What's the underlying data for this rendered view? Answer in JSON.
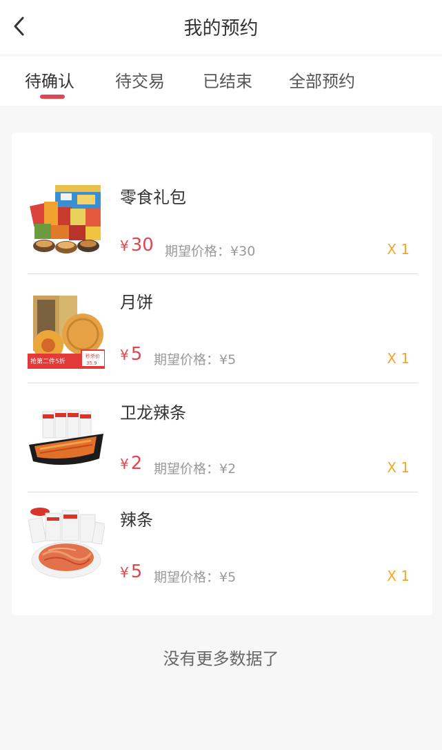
{
  "header": {
    "title": "我的预约"
  },
  "tabs": [
    {
      "label": "待确认",
      "active": true
    },
    {
      "label": "待交易",
      "active": false
    },
    {
      "label": "已结束",
      "active": false
    },
    {
      "label": "全部预约",
      "active": false
    }
  ],
  "items": [
    {
      "name": "零食礼包",
      "currency": "¥",
      "price": "30",
      "expect_label": "期望价格：",
      "expect_price": "¥30",
      "qty": "X 1",
      "image": "snack-gift-box-image"
    },
    {
      "name": "月饼",
      "currency": "¥",
      "price": "5",
      "expect_label": "期望价格：",
      "expect_price": "¥5",
      "qty": "X 1",
      "image": "mooncake-image",
      "image_text": {
        "promo": "抢第二件5折",
        "badge": "秒杀价",
        "badge_price": "35.9"
      }
    },
    {
      "name": "卫龙辣条",
      "currency": "¥",
      "price": "2",
      "expect_label": "期望价格：",
      "expect_price": "¥2",
      "qty": "X 1",
      "image": "weilong-latiao-image"
    },
    {
      "name": "辣条",
      "currency": "¥",
      "price": "5",
      "expect_label": "期望价格：",
      "expect_price": "¥5",
      "qty": "X 1",
      "image": "latiao-image"
    }
  ],
  "footer": {
    "no_more": "没有更多数据了"
  },
  "colors": {
    "accent_red": "#e0464f",
    "qty_orange": "#f5a623",
    "muted_gray": "#999999"
  }
}
